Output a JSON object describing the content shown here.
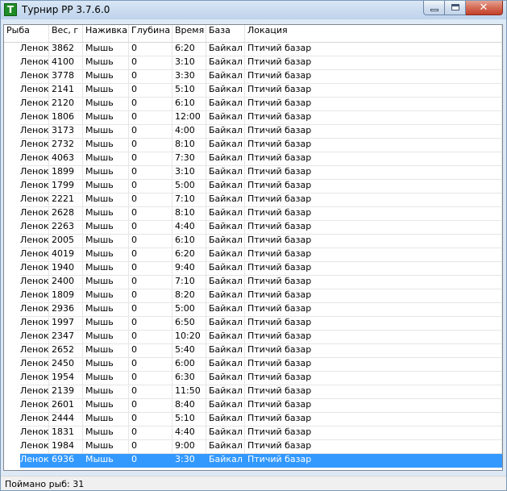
{
  "window": {
    "title": "Турнир РР 3.7.6.0",
    "icon_letter": "T",
    "close_glyph": "✕"
  },
  "table": {
    "columns": [
      "Рыба",
      "Вес, г",
      "Наживка",
      "Глубина",
      "Время",
      "База",
      "Локация"
    ],
    "rows": [
      [
        "Ленок",
        "3862",
        "Мышь",
        "0",
        "6:20",
        "Байкал",
        "Птичий базар"
      ],
      [
        "Ленок",
        "4100",
        "Мышь",
        "0",
        "3:10",
        "Байкал",
        "Птичий базар"
      ],
      [
        "Ленок",
        "3778",
        "Мышь",
        "0",
        "3:30",
        "Байкал",
        "Птичий базар"
      ],
      [
        "Ленок",
        "2141",
        "Мышь",
        "0",
        "5:10",
        "Байкал",
        "Птичий базар"
      ],
      [
        "Ленок",
        "2120",
        "Мышь",
        "0",
        "6:10",
        "Байкал",
        "Птичий базар"
      ],
      [
        "Ленок",
        "1806",
        "Мышь",
        "0",
        "12:00",
        "Байкал",
        "Птичий базар"
      ],
      [
        "Ленок",
        "3173",
        "Мышь",
        "0",
        "4:00",
        "Байкал",
        "Птичий базар"
      ],
      [
        "Ленок",
        "2732",
        "Мышь",
        "0",
        "8:10",
        "Байкал",
        "Птичий базар"
      ],
      [
        "Ленок",
        "4063",
        "Мышь",
        "0",
        "7:30",
        "Байкал",
        "Птичий базар"
      ],
      [
        "Ленок",
        "1899",
        "Мышь",
        "0",
        "3:10",
        "Байкал",
        "Птичий базар"
      ],
      [
        "Ленок",
        "1799",
        "Мышь",
        "0",
        "5:00",
        "Байкал",
        "Птичий базар"
      ],
      [
        "Ленок",
        "2221",
        "Мышь",
        "0",
        "7:10",
        "Байкал",
        "Птичий базар"
      ],
      [
        "Ленок",
        "2628",
        "Мышь",
        "0",
        "8:10",
        "Байкал",
        "Птичий базар"
      ],
      [
        "Ленок",
        "2263",
        "Мышь",
        "0",
        "4:40",
        "Байкал",
        "Птичий базар"
      ],
      [
        "Ленок",
        "2005",
        "Мышь",
        "0",
        "6:10",
        "Байкал",
        "Птичий базар"
      ],
      [
        "Ленок",
        "4019",
        "Мышь",
        "0",
        "6:20",
        "Байкал",
        "Птичий базар"
      ],
      [
        "Ленок",
        "1940",
        "Мышь",
        "0",
        "9:40",
        "Байкал",
        "Птичий базар"
      ],
      [
        "Ленок",
        "2400",
        "Мышь",
        "0",
        "7:10",
        "Байкал",
        "Птичий базар"
      ],
      [
        "Ленок",
        "1809",
        "Мышь",
        "0",
        "8:20",
        "Байкал",
        "Птичий базар"
      ],
      [
        "Ленок",
        "2936",
        "Мышь",
        "0",
        "5:00",
        "Байкал",
        "Птичий базар"
      ],
      [
        "Ленок",
        "1997",
        "Мышь",
        "0",
        "6:50",
        "Байкал",
        "Птичий базар"
      ],
      [
        "Ленок",
        "2347",
        "Мышь",
        "0",
        "10:20",
        "Байкал",
        "Птичий базар"
      ],
      [
        "Ленок",
        "2652",
        "Мышь",
        "0",
        "5:40",
        "Байкал",
        "Птичий базар"
      ],
      [
        "Ленок",
        "2450",
        "Мышь",
        "0",
        "6:00",
        "Байкал",
        "Птичий базар"
      ],
      [
        "Ленок",
        "1954",
        "Мышь",
        "0",
        "6:30",
        "Байкал",
        "Птичий базар"
      ],
      [
        "Ленок",
        "2139",
        "Мышь",
        "0",
        "11:50",
        "Байкал",
        "Птичий базар"
      ],
      [
        "Ленок",
        "2601",
        "Мышь",
        "0",
        "8:40",
        "Байкал",
        "Птичий базар"
      ],
      [
        "Ленок",
        "2444",
        "Мышь",
        "0",
        "5:10",
        "Байкал",
        "Птичий базар"
      ],
      [
        "Ленок",
        "1831",
        "Мышь",
        "0",
        "4:40",
        "Байкал",
        "Птичий базар"
      ],
      [
        "Ленок",
        "1984",
        "Мышь",
        "0",
        "9:00",
        "Байкал",
        "Птичий базар"
      ],
      [
        "Ленок",
        "6936",
        "Мышь",
        "0",
        "3:30",
        "Байкал",
        "Птичий базар"
      ]
    ],
    "selected_row": 30
  },
  "status": {
    "text": "Поймано рыб: 31"
  },
  "colors": {
    "selection": "#3399ff",
    "selection_text": "#ffffff"
  }
}
